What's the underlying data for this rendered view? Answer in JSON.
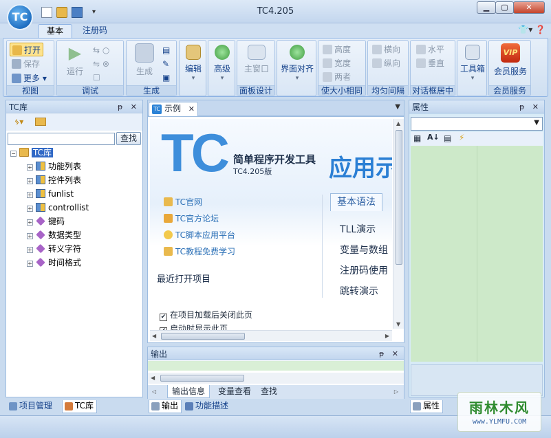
{
  "window": {
    "app_icon": "TC",
    "title": "TC4.205",
    "minimize": "▁",
    "maximize": "▢",
    "close": "✕",
    "quick_access_menu": "▾"
  },
  "ribbon": {
    "tabs": [
      "基本",
      "注册码"
    ],
    "right_controls": "👕▾ ❓",
    "groups": {
      "view": {
        "label": "视图",
        "open": "打开",
        "save": "保存",
        "more": "更多"
      },
      "debug": {
        "label": "调试",
        "run": "运行"
      },
      "build": {
        "label": "生成",
        "build": "生成"
      },
      "edit": {
        "label": "编辑"
      },
      "advanced": {
        "label": "高级"
      },
      "panel_design": {
        "label": "面板设计",
        "main_window": "主窗口"
      },
      "align": {
        "label": "界面对齐"
      },
      "same_size": {
        "label": "使大小相同",
        "height": "高度",
        "width": "宽度",
        "both": "两者"
      },
      "spacing": {
        "label": "均匀间隔",
        "horizontal": "横向",
        "vertical": "纵向"
      },
      "dialog_center": {
        "label": "对话框居中",
        "horizontal": "水平",
        "vertical": "垂直"
      },
      "toolbox": {
        "label": "工具箱"
      },
      "vip": {
        "label": "会员服务",
        "button": "会员服务",
        "badge": "VIP"
      }
    }
  },
  "left_panel": {
    "title": "TC库",
    "pin_close": "ᵽ ✕",
    "search_placeholder": "",
    "search_button": "查找",
    "tree_root": "TC库",
    "tree_items": [
      {
        "label": "功能列表",
        "icon": "grid"
      },
      {
        "label": "控件列表",
        "icon": "grid"
      },
      {
        "label": "funlist",
        "icon": "grid"
      },
      {
        "label": "controllist",
        "icon": "grid"
      },
      {
        "label": "键码",
        "icon": "diamond"
      },
      {
        "label": "数据类型",
        "icon": "diamond"
      },
      {
        "label": "转义字符",
        "icon": "diamond"
      },
      {
        "label": "时间格式",
        "icon": "diamond"
      }
    ],
    "bottom_tabs": [
      "项目管理",
      "TC库"
    ]
  },
  "document": {
    "tab_label": "示例",
    "logo_text": "TC",
    "subtitle": "简单程序开发工具",
    "version": "TC4.205版",
    "big_text": "应用示",
    "links": [
      "TC官网",
      "TC官方论坛",
      "TC脚本应用平台",
      "TC教程免费学习"
    ],
    "recent_title": "最近打开项目",
    "syntax_tab": "基本语法",
    "syntax_items": [
      "TLL演示",
      "变量与数组",
      "注册码使用",
      "跳转演示"
    ],
    "checkboxes": [
      {
        "label": "在项目加载后关闭此页",
        "checked": true
      },
      {
        "label": "启动时显示此页",
        "checked": true
      }
    ]
  },
  "output_panel": {
    "title": "输出",
    "tabs": [
      "输出信息",
      "变量查看",
      "查找"
    ],
    "bottom_tabs": [
      "输出",
      "功能描述"
    ]
  },
  "properties_panel": {
    "title": "属性",
    "bottom_tabs": [
      "属性"
    ]
  },
  "watermark": {
    "main": "雨林木风",
    "url": "www.YLMFU.COM"
  },
  "colors": {
    "ribbon_text": "#15428b",
    "accent_blue": "#3e8edb",
    "properties_grid": "#cde9c9",
    "watermark_green": "#2e8b2e"
  }
}
